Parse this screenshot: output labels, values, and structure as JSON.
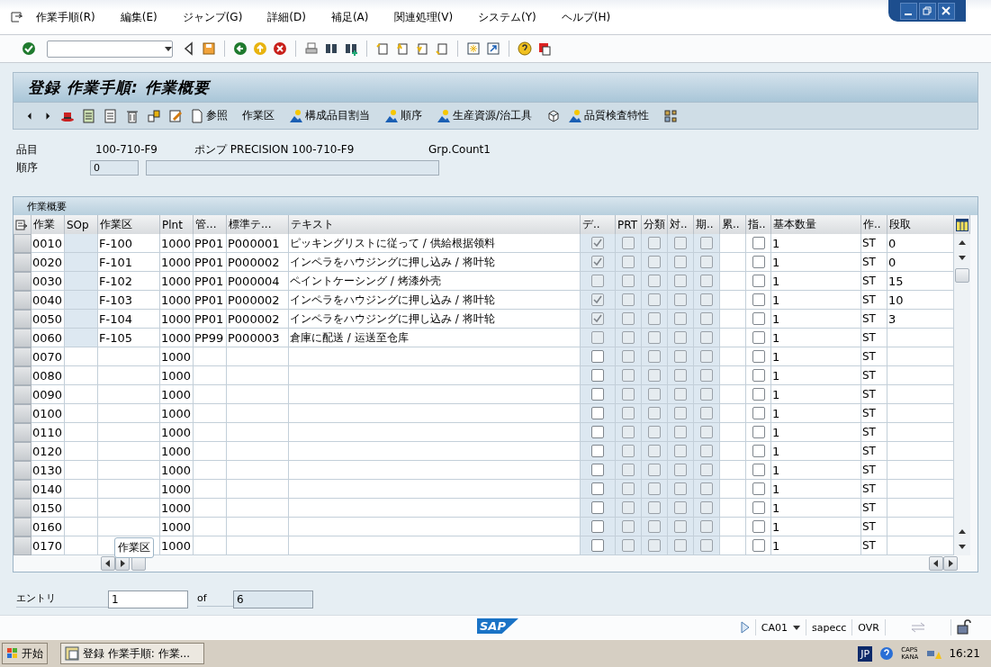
{
  "menu": [
    "作業手順(R)",
    "編集(E)",
    "ジャンプ(G)",
    "詳細(D)",
    "補足(A)",
    "関連処理(V)",
    "システム(Y)",
    "ヘルプ(H)"
  ],
  "title": "登録 作業手順: 作業概要",
  "app_toolbar": [
    {
      "kind": "icon"
    },
    {
      "kind": "icon"
    },
    {
      "kind": "icon"
    },
    {
      "kind": "icon"
    },
    {
      "kind": "icon"
    },
    {
      "kind": "icon"
    },
    {
      "kind": "icon"
    },
    {
      "kind": "icon"
    },
    {
      "kind": "button",
      "label": "参照"
    },
    {
      "kind": "button",
      "label": "作業区"
    },
    {
      "kind": "button",
      "label": "構成品目割当"
    },
    {
      "kind": "button",
      "label": "順序"
    },
    {
      "kind": "button",
      "label": "生産資源/治工具"
    },
    {
      "kind": "icon"
    },
    {
      "kind": "button",
      "label": "品質検査特性"
    },
    {
      "kind": "icon"
    }
  ],
  "header": {
    "material_label": "品目",
    "material": "100-710-F9",
    "description": "ポンプ PRECISION 100-710-F9",
    "group_counter": "Grp.Count1",
    "sequence_label": "順序",
    "sequence": "0"
  },
  "table": {
    "title": "作業概要",
    "columns": [
      "作業",
      "SOp",
      "作業区",
      "Plnt",
      "管...",
      "標準テ...",
      "テキスト",
      "デ..",
      "PRT",
      "分類",
      "対..",
      "期..",
      "累..",
      "指..",
      "基本数量",
      "作..",
      "段取"
    ],
    "rows": [
      {
        "op": "0010",
        "work_center": "F-100",
        "plant": "1000",
        "control_key": "PP01",
        "std_text_key": "P000001",
        "text": "ピッキングリストに従って / 供給根据领料",
        "disabled": true,
        "checks": [
          true,
          false,
          false,
          false,
          false,
          false
        ],
        "base_qty": "1",
        "unit": "ST",
        "setup": "0"
      },
      {
        "op": "0020",
        "work_center": "F-101",
        "plant": "1000",
        "control_key": "PP01",
        "std_text_key": "P000002",
        "text": "インペラをハウジングに押し込み / 将叶轮",
        "disabled": true,
        "checks": [
          true,
          false,
          false,
          false,
          false,
          false
        ],
        "base_qty": "1",
        "unit": "ST",
        "setup": "0"
      },
      {
        "op": "0030",
        "work_center": "F-102",
        "plant": "1000",
        "control_key": "PP01",
        "std_text_key": "P000004",
        "text": "ペイントケーシング / 烤漆外壳",
        "disabled": true,
        "checks": [
          false,
          false,
          false,
          false,
          false,
          false
        ],
        "base_qty": "1",
        "unit": "ST",
        "setup": "15"
      },
      {
        "op": "0040",
        "work_center": "F-103",
        "plant": "1000",
        "control_key": "PP01",
        "std_text_key": "P000002",
        "text": "インペラをハウジングに押し込み / 将叶轮",
        "disabled": true,
        "checks": [
          true,
          false,
          false,
          false,
          false,
          false
        ],
        "base_qty": "1",
        "unit": "ST",
        "setup": "10"
      },
      {
        "op": "0050",
        "work_center": "F-104",
        "plant": "1000",
        "control_key": "PP01",
        "std_text_key": "P000002",
        "text": "インペラをハウジングに押し込み / 将叶轮",
        "disabled": true,
        "checks": [
          true,
          false,
          false,
          false,
          false,
          false
        ],
        "base_qty": "1",
        "unit": "ST",
        "setup": "3"
      },
      {
        "op": "0060",
        "work_center": "F-105",
        "plant": "1000",
        "control_key": "PP99",
        "std_text_key": "P000003",
        "text": "倉庫に配送 / 运送至仓库",
        "disabled": true,
        "checks": [
          false,
          false,
          false,
          false,
          false,
          false
        ],
        "base_qty": "1",
        "unit": "ST"
      },
      {
        "op": "0070",
        "plant": "1000",
        "disabled": false,
        "checks": [
          false,
          false,
          false,
          false,
          false,
          false
        ],
        "base_qty": "1",
        "unit": "ST"
      },
      {
        "op": "0080",
        "plant": "1000",
        "disabled": false,
        "checks": [
          false,
          false,
          false,
          false,
          false,
          false
        ],
        "base_qty": "1",
        "unit": "ST"
      },
      {
        "op": "0090",
        "plant": "1000",
        "disabled": false,
        "checks": [
          false,
          false,
          false,
          false,
          false,
          false
        ],
        "base_qty": "1",
        "unit": "ST"
      },
      {
        "op": "0100",
        "plant": "1000",
        "disabled": false,
        "checks": [
          false,
          false,
          false,
          false,
          false,
          false
        ],
        "base_qty": "1",
        "unit": "ST"
      },
      {
        "op": "0110",
        "plant": "1000",
        "disabled": false,
        "checks": [
          false,
          false,
          false,
          false,
          false,
          false
        ],
        "base_qty": "1",
        "unit": "ST"
      },
      {
        "op": "0120",
        "plant": "1000",
        "disabled": false,
        "checks": [
          false,
          false,
          false,
          false,
          false,
          false
        ],
        "base_qty": "1",
        "unit": "ST"
      },
      {
        "op": "0130",
        "plant": "1000",
        "disabled": false,
        "checks": [
          false,
          false,
          false,
          false,
          false,
          false
        ],
        "base_qty": "1",
        "unit": "ST"
      },
      {
        "op": "0140",
        "plant": "1000",
        "disabled": false,
        "checks": [
          false,
          false,
          false,
          false,
          false,
          false
        ],
        "base_qty": "1",
        "unit": "ST"
      },
      {
        "op": "0150",
        "plant": "1000",
        "disabled": false,
        "checks": [
          false,
          false,
          false,
          false,
          false,
          false
        ],
        "base_qty": "1",
        "unit": "ST"
      },
      {
        "op": "0160",
        "plant": "1000",
        "disabled": false,
        "checks": [
          false,
          false,
          false,
          false,
          false,
          false
        ],
        "base_qty": "1",
        "unit": "ST"
      },
      {
        "op": "0170",
        "plant": "1000",
        "disabled": false,
        "checks": [
          false,
          false,
          false,
          false,
          false,
          false
        ],
        "base_qty": "1",
        "unit": "ST"
      }
    ],
    "tooltip": "作業区"
  },
  "entry": {
    "label": "エントリ",
    "value": "1",
    "of_label": "of",
    "total": "6"
  },
  "status_bar": {
    "logo": "SAP",
    "transaction": "CA01",
    "server": "sapecc",
    "mode": "OVR"
  },
  "taskbar": {
    "start": "开始",
    "task": "登録 作業手順: 作業...",
    "language": "JP",
    "caps": "CAPS",
    "kana": "KANA",
    "clock": "16:21"
  }
}
